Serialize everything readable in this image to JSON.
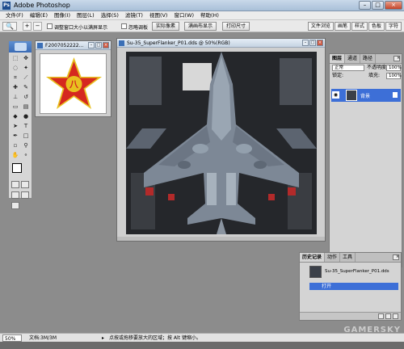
{
  "window": {
    "title": "Adobe Photoshop",
    "min": "–",
    "max": "□",
    "close": "×"
  },
  "menu": [
    "文件(F)",
    "编辑(E)",
    "图像(I)",
    "图层(L)",
    "选择(S)",
    "滤镜(T)",
    "视图(V)",
    "窗口(W)",
    "帮助(H)"
  ],
  "options": {
    "check1_label": "调整窗口大小以满屏显示",
    "check2_label": "忽略调板",
    "btn_actual": "实际像素",
    "btn_fit": "满画布显示",
    "btn_print": "打印尺寸",
    "wells": [
      "文件浏览",
      "画笔",
      "样式",
      "色板",
      "字符"
    ]
  },
  "doc_star": {
    "title": "F2007052222...",
    "glyph": "八"
  },
  "doc_jet": {
    "title": "Su-35_SuperFlanker_P01.dds @ 50%(RGB)"
  },
  "layers": {
    "tabs": [
      "图层",
      "通道",
      "路径"
    ],
    "blend_mode": "正常",
    "opacity_label": "不透明度:",
    "opacity_value": "100%",
    "lock_label": "锁定:",
    "fill_label": "填充:",
    "fill_value": "100%",
    "layer_name": "背景"
  },
  "history": {
    "tabs": [
      "历史记录",
      "动作",
      "工具"
    ],
    "snapshot_name": "Su-35_SuperFlanker_P01.dds",
    "state_name": "打开"
  },
  "status": {
    "zoom": "50%",
    "doc_size": "文档:3M/3M",
    "arrow": "▸",
    "hint": "点按或拖移要放大的区域；按 Alt 键缩小。"
  },
  "watermark": "GAMERSKY",
  "colors": {
    "star_red": "#d5281f",
    "star_gold": "#e8c020",
    "selection_blue": "#3d6fd7",
    "titlebar": "#b7cade"
  }
}
